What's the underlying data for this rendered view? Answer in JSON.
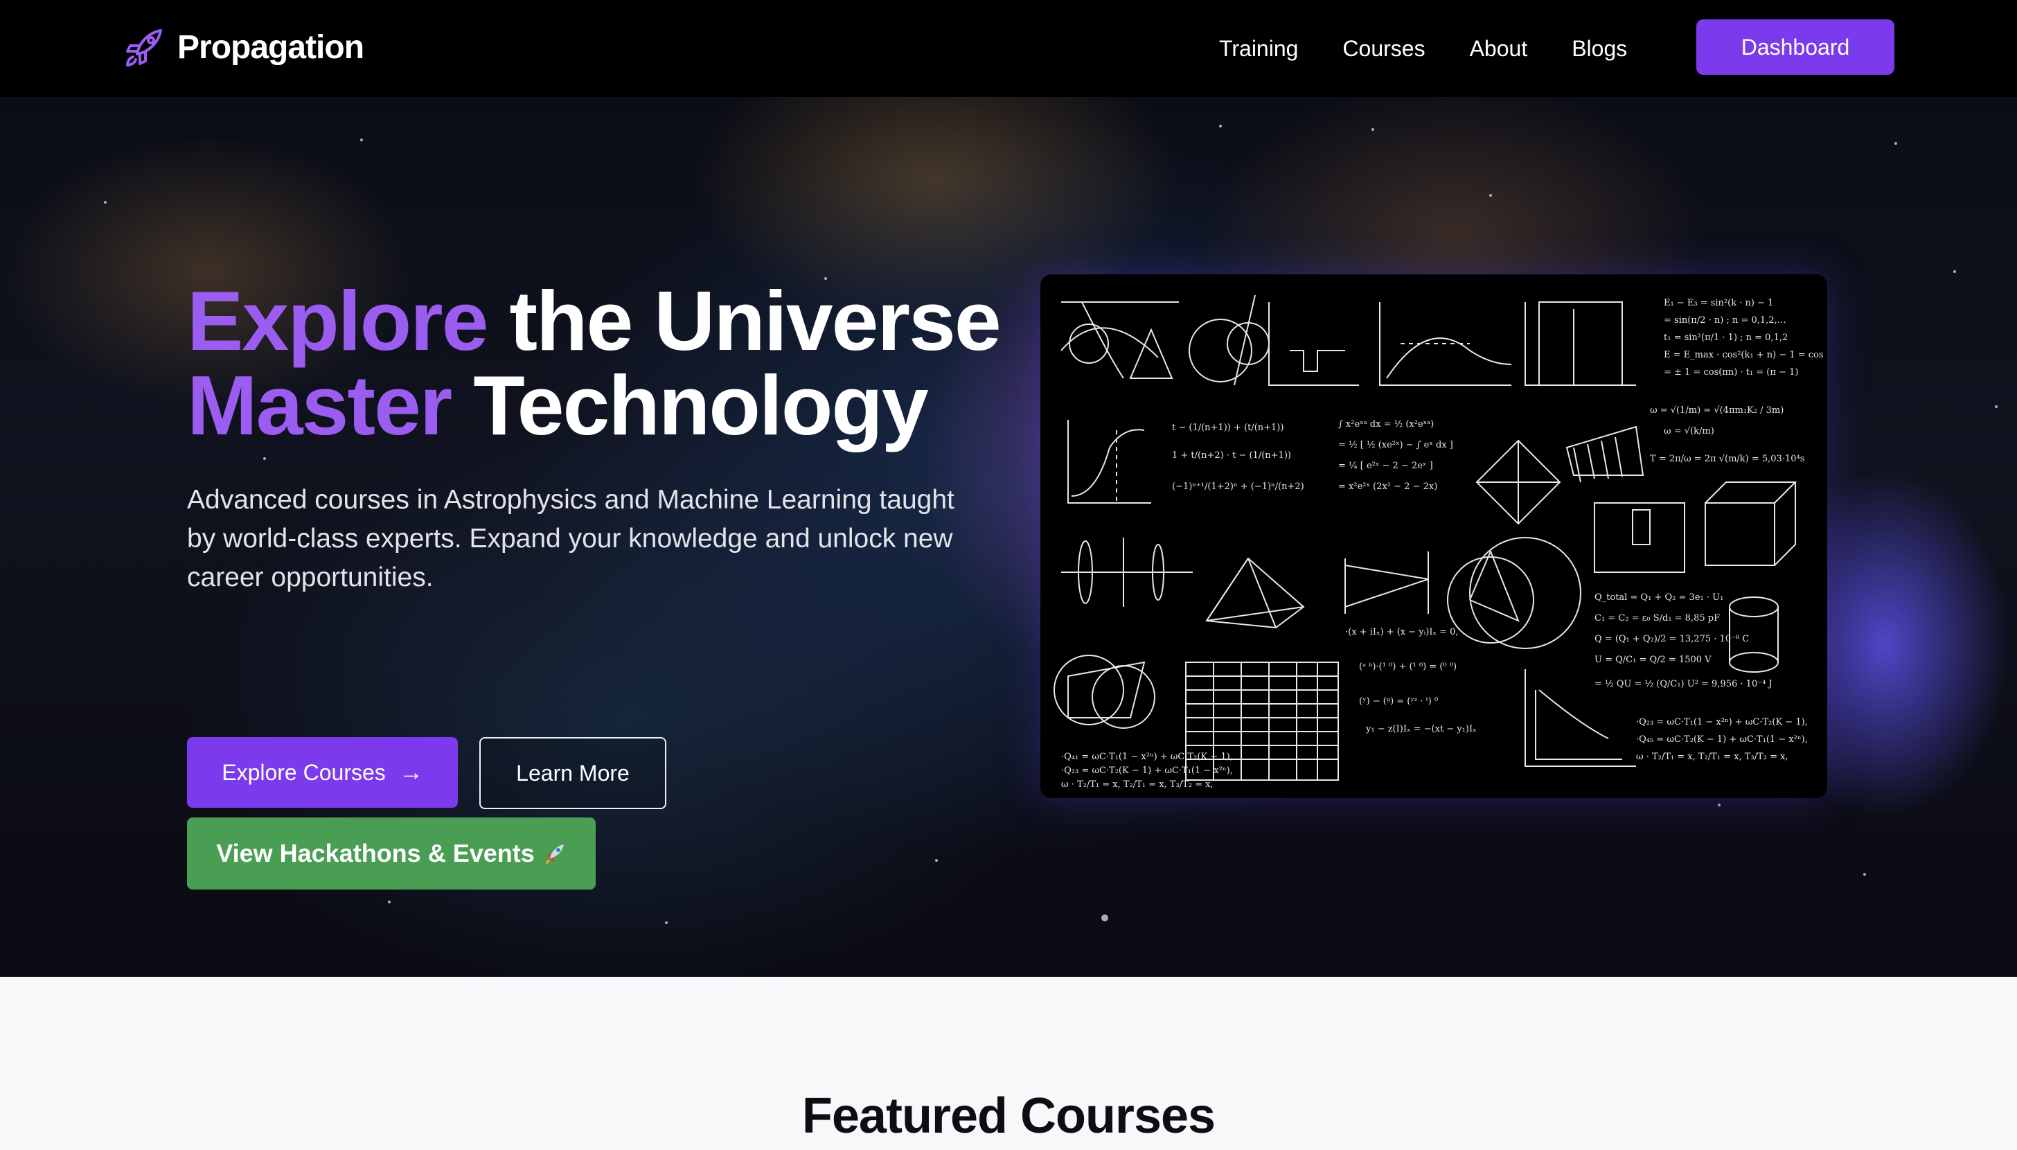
{
  "nav": {
    "brand": "Propagation",
    "brand_icon": "rocket-icon",
    "links": [
      "Training",
      "Courses",
      "About",
      "Blogs"
    ],
    "dashboard_label": "Dashboard"
  },
  "hero": {
    "title_line1_accent": "Explore",
    "title_line1_rest": " the Universe",
    "title_line2_accent": "Master",
    "title_line2_rest": " Technology",
    "subtitle": "Advanced courses in Astrophysics and Machine Learning taught by world-class experts. Expand your knowledge and unlock new career opportunities.",
    "primary_button": "Explore Courses",
    "secondary_button": "Learn More",
    "events_button": "View Hackathons & Events",
    "events_icon": "rocket-icon",
    "image_label": "physics equations blackboard image"
  },
  "featured": {
    "title": "Featured Courses"
  },
  "colors": {
    "accent": "#7c3aed",
    "accent_text": "#9b5cf0",
    "green": "#4a9e53",
    "nav_bg": "#000000"
  }
}
